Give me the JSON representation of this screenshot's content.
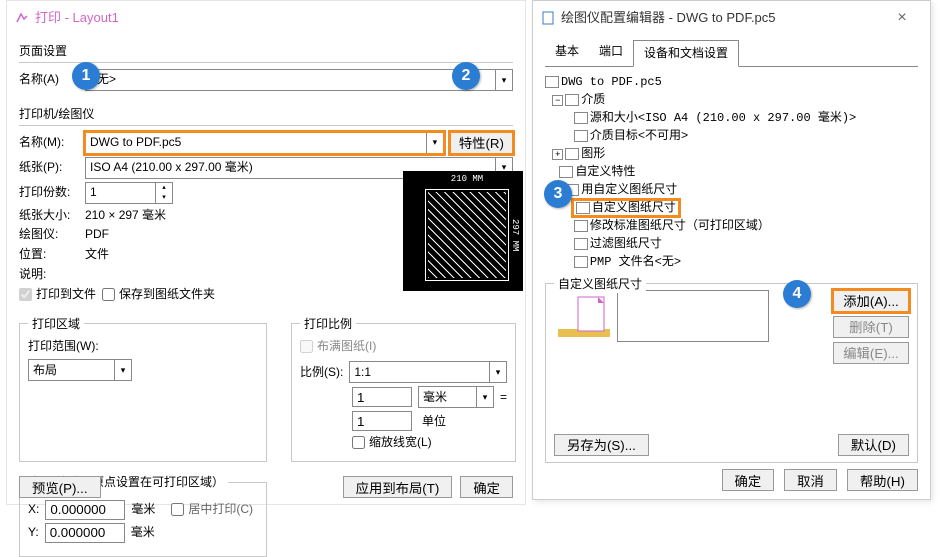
{
  "left_win": {
    "title": "打印 - Layout1",
    "page_setup": {
      "group": "页面设置",
      "name_lbl": "名称(A)",
      "name_val": "<无>"
    },
    "printer": {
      "group": "打印机/绘图仪",
      "name_lbl": "名称(M):",
      "name_val": "DWG to PDF.pc5",
      "props_btn": "特性(R)",
      "paper_lbl": "纸张(P):",
      "paper_val": "ISO A4 (210.00 x 297.00 毫米)",
      "copies_lbl": "打印份数:",
      "copies_val": "1",
      "size_lbl": "纸张大小:",
      "size_val": "210 × 297 毫米",
      "plotter_lbl": "绘图仪:",
      "plotter_val": "PDF",
      "where_lbl": "位置:",
      "where_val": "文件",
      "desc_lbl": "说明:",
      "tofile_lbl": "打印到文件",
      "savefolder_lbl": "保存到图纸文件夹",
      "preview_top": "210 MM",
      "preview_right": "297 MM"
    },
    "area": {
      "legend": "打印区域",
      "range_lbl": "打印范围(W):",
      "range_val": "布局"
    },
    "scale": {
      "legend": "打印比例",
      "fit_lbl": "布满图纸(I)",
      "ratio_lbl": "比例(S):",
      "ratio_val": "1:1",
      "val1": "1",
      "unit1": "毫米",
      "eq": "=",
      "val2": "1",
      "unit2": "单位",
      "lw_lbl": "缩放线宽(L)"
    },
    "offset": {
      "legend": "打印偏移（原点设置在可打印区域）",
      "x": "X:",
      "xv": "0.000000",
      "xu": "毫米",
      "y": "Y:",
      "yv": "0.000000",
      "yu": "毫米",
      "center_lbl": "居中打印(C)"
    },
    "btn_preview": "预览(P)...",
    "btn_apply": "应用到布局(T)",
    "btn_ok": "确定"
  },
  "right_win": {
    "title": "绘图仪配置编辑器 - DWG to PDF.pc5",
    "tabs": {
      "basic": "基本",
      "port": "端口",
      "dev": "设备和文档设置"
    },
    "tree": {
      "root": "DWG to PDF.pc5",
      "media": "介质",
      "src": "源和大小<ISO A4 (210.00 x 297.00 毫米)>",
      "target": "介质目标<不可用>",
      "graphics": "图形",
      "custom": "自定义特性",
      "userpaper": "用自定义图纸尺寸",
      "custompaper": "自定义图纸尺寸",
      "modstd": "修改标准图纸尺寸（可打印区域）",
      "filter": "过滤图纸尺寸",
      "pmp": "PMP 文件名<无>"
    },
    "custom_group": {
      "legend": "自定义图纸尺寸",
      "add": "添加(A)...",
      "del": "删除(T)",
      "edit": "编辑(E)..."
    },
    "btn_saveas": "另存为(S)...",
    "btn_default": "默认(D)",
    "btn_ok": "确定",
    "btn_cancel": "取消",
    "btn_help": "帮助(H)"
  },
  "badges": {
    "b1": "1",
    "b2": "2",
    "b3": "3",
    "b4": "4"
  }
}
